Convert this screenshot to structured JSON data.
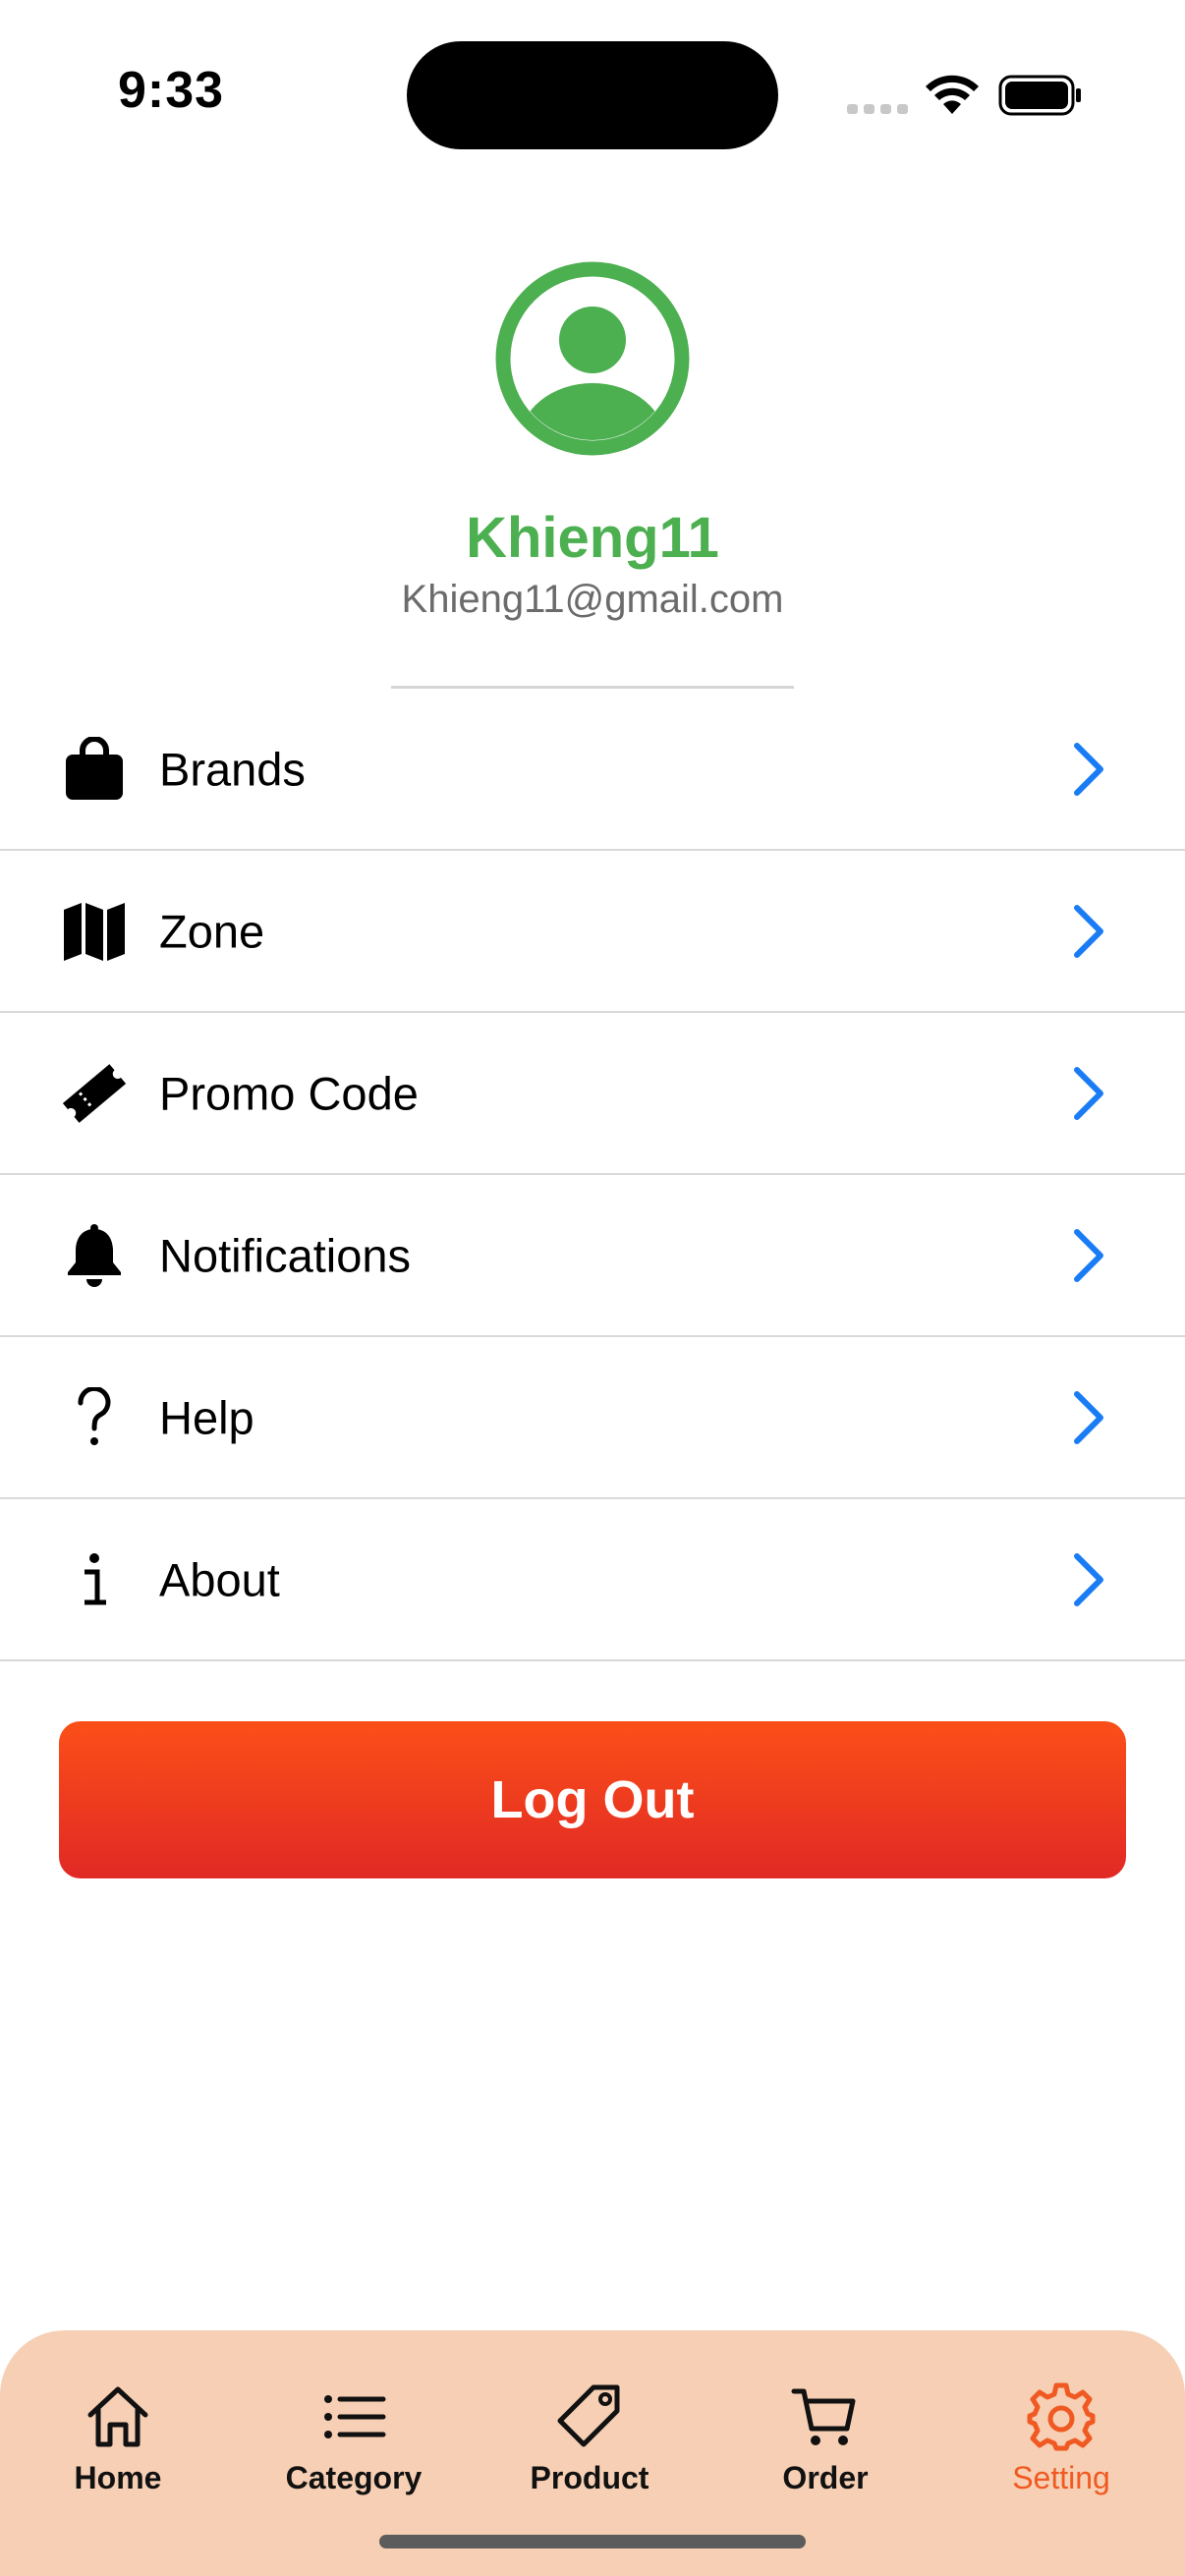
{
  "status_bar": {
    "time": "9:33",
    "signal_icon": "cellular-signal-icon",
    "wifi_icon": "wifi-icon",
    "battery_icon": "battery-icon"
  },
  "profile": {
    "avatar_icon": "user-avatar-icon",
    "name": "Khieng11",
    "email": "Khieng11@gmail.com",
    "accent_color": "#4caf50"
  },
  "menu": {
    "items": [
      {
        "label": "Brands",
        "icon": "shopping-bag-icon"
      },
      {
        "label": "Zone",
        "icon": "map-icon"
      },
      {
        "label": "Promo Code",
        "icon": "ticket-icon"
      },
      {
        "label": "Notifications",
        "icon": "bell-icon"
      },
      {
        "label": "Help",
        "icon": "question-mark-icon"
      },
      {
        "label": "About",
        "icon": "info-icon"
      }
    ],
    "chevron_icon": "chevron-right-icon",
    "chevron_color": "#1a7cf5"
  },
  "logout": {
    "label": "Log Out",
    "color_top": "#fb4f18",
    "color_bottom": "#e12925"
  },
  "tab_bar": {
    "background": "#f6cfb4",
    "active_color": "#f05a22",
    "tabs": [
      {
        "label": "Home",
        "icon": "home-icon",
        "active": false
      },
      {
        "label": "Category",
        "icon": "list-icon",
        "active": false
      },
      {
        "label": "Product",
        "icon": "tag-icon",
        "active": false
      },
      {
        "label": "Order",
        "icon": "cart-icon",
        "active": false
      },
      {
        "label": "Setting",
        "icon": "gear-icon",
        "active": true
      }
    ]
  }
}
